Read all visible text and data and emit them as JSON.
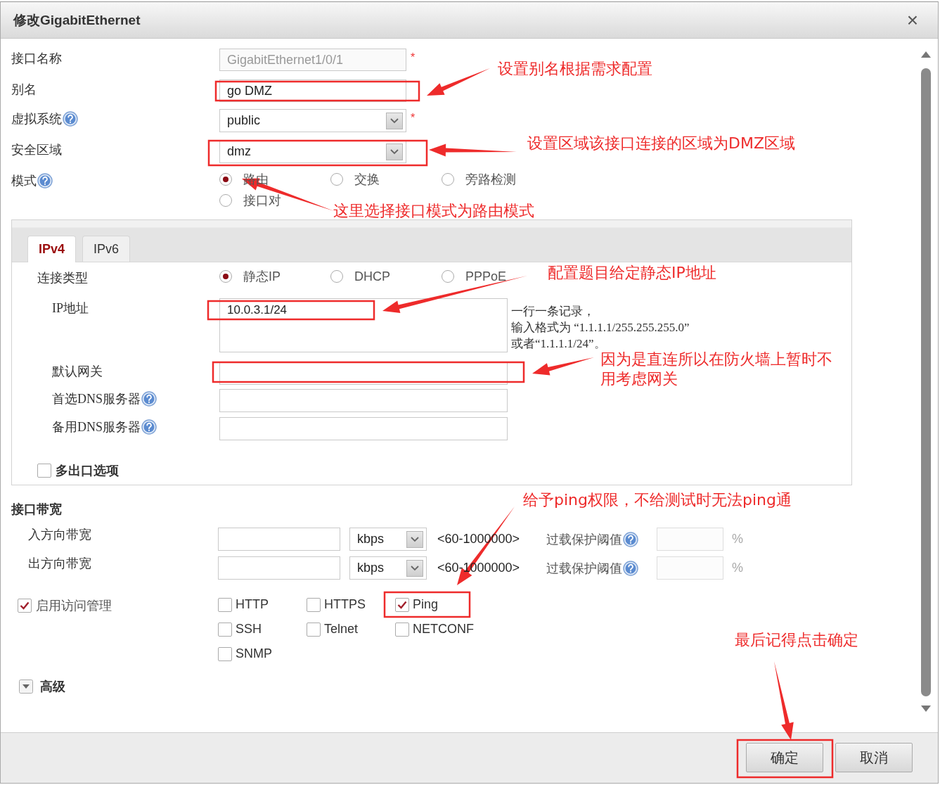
{
  "window": {
    "title": "修改GigabitEthernet",
    "close": "×"
  },
  "fields": [
    {
      "kind": "text",
      "label": "接口名称",
      "value": "GigabitEthernet1/0/1",
      "disabled": true,
      "required": "*"
    },
    {
      "kind": "text",
      "label": "别名",
      "value": "go DMZ",
      "disabled": false
    },
    {
      "kind": "select",
      "label": "虚拟系统",
      "help": true,
      "value": "public",
      "required": "*"
    },
    {
      "kind": "select",
      "label": "安全区域",
      "value": "dmz"
    },
    {
      "kind": "radio",
      "label": "模式",
      "help": true,
      "options": [
        {
          "label": "路由",
          "selected": true
        },
        {
          "label": "交换",
          "selected": false
        },
        {
          "label": "旁路检测",
          "selected": false
        },
        {
          "label": "接口对",
          "selected": false
        }
      ]
    }
  ],
  "ip_tabs": [
    {
      "label": "IPv4",
      "selected": true
    },
    {
      "label": "IPv6",
      "selected": false
    }
  ],
  "ipv4": {
    "connection_type": {
      "label": "连接类型",
      "options": [
        {
          "label": "静态IP",
          "selected": true
        },
        {
          "label": "DHCP",
          "selected": false
        },
        {
          "label": "PPPoE",
          "selected": false
        }
      ]
    },
    "ip_address": {
      "label": "IP地址",
      "value": "10.0.3.1/24",
      "hint": [
        "一行一条记录，",
        "输入格式为 “1.1.1.1/255.255.255.0”",
        "或者“1.1.1.1/24”。"
      ]
    },
    "gateway": {
      "label": "默认网关"
    },
    "dns": [
      {
        "label": "首选DNS服务器",
        "help": true
      },
      {
        "label": "备用DNS服务器",
        "help": true
      }
    ],
    "multi_exit": {
      "label": "多出口选项",
      "checked": false
    }
  },
  "bandwidth": {
    "title": "接口带宽",
    "rows": [
      {
        "label": "入方向带宽",
        "unit": "kbps",
        "range": "<60-1000000>",
        "overload_label": "过载保护阈值",
        "percent": "%"
      },
      {
        "label": "出方向带宽",
        "unit": "kbps",
        "range": "<60-1000000>",
        "overload_label": "过载保护阈值",
        "percent": "%"
      }
    ]
  },
  "access": {
    "label": "启用访问管理",
    "checked": true,
    "services": [
      {
        "label": "HTTP",
        "checked": false
      },
      {
        "label": "HTTPS",
        "checked": false
      },
      {
        "label": "Ping",
        "checked": true
      },
      {
        "label": "SSH",
        "checked": false
      },
      {
        "label": "Telnet",
        "checked": false
      },
      {
        "label": "NETCONF",
        "checked": false
      },
      {
        "label": "SNMP",
        "checked": false
      }
    ]
  },
  "advanced": {
    "label": "高级"
  },
  "buttons": [
    {
      "label": "确定"
    },
    {
      "label": "取消"
    }
  ],
  "annotations": [
    {
      "text": "设置别名根据需求配置"
    },
    {
      "text": "设置区域该接口连接的区域为DMZ区域"
    },
    {
      "text": "这里选择接口模式为路由模式"
    },
    {
      "text": "配置题目给定静态IP地址"
    },
    {
      "text": "因为是直连所以在防火墙上暂时不用考虑网关"
    },
    {
      "text": "给予ping权限，不给测试时无法ping通"
    },
    {
      "text": "最后记得点击确定"
    }
  ]
}
